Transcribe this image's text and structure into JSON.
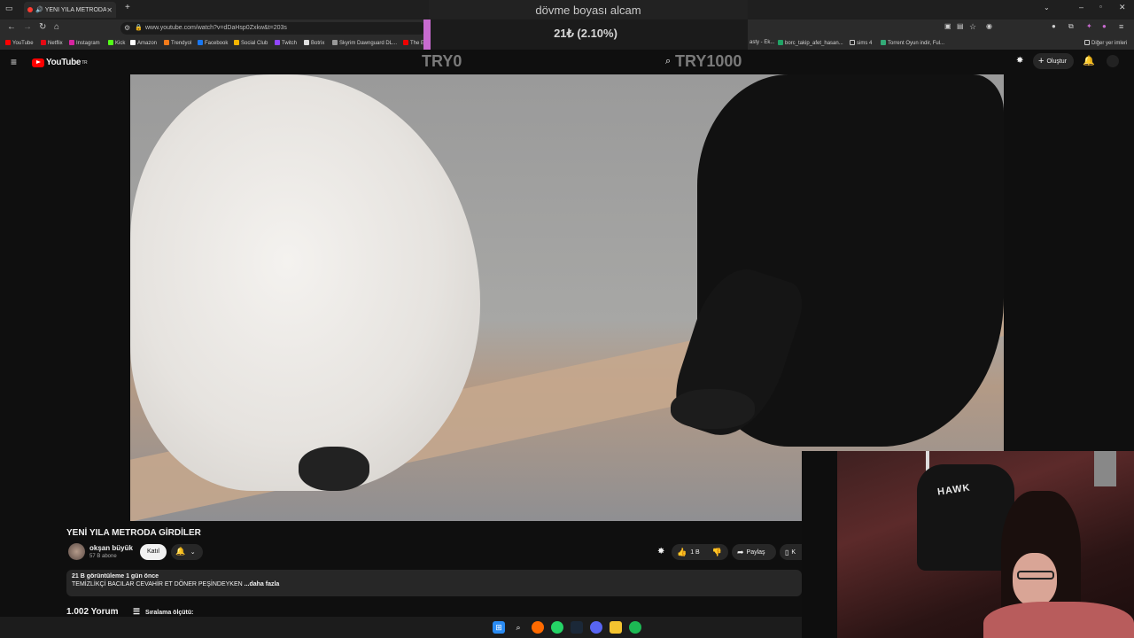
{
  "browser": {
    "tab_title": "YENİ YILA METRODA GİRDİ",
    "url": "www.youtube.com/watch?v=dDaHsp0Zxkw&t=203s",
    "bookmarks": [
      "YouTube",
      "Netflix",
      "Instagram",
      "Kick",
      "Amazon",
      "Trendyol",
      "Facebook",
      "Social Club",
      "Twitch",
      "Botrix",
      "Skyrim Dawnguard DL...",
      "The E",
      "asty - Ek...",
      "borc_takip_afet_hasan...",
      "sims 4",
      "Torrent Oyun indir, Ful...",
      "Diğer yer imleri"
    ]
  },
  "overlay": {
    "goal_title": "dövme boyası alcam",
    "goal_text": "21₺ (2.10%)",
    "goal_percent": 2.1,
    "min_label": "TRY0",
    "max_label": "TRY1000"
  },
  "youtube": {
    "logo_text": "YouTube",
    "logo_region": "TR",
    "create_label": "Oluştur",
    "video_title": "YENİ YILA METRODA GİRDİLER",
    "channel_name": "okşan büyük",
    "subscribers": "57 B abone",
    "join_label": "Katıl",
    "likes": "1 B",
    "share_label": "Paylaş",
    "save_label_partial": "K",
    "views_date": "21 B görüntüleme  1 gün önce",
    "description": "TEMİZLİKÇİ BACILAR CEVAHİR ET DÖNER PEŞİNDEYKEN",
    "more_label": "...daha fazla",
    "comments_count": "1.002 Yorum",
    "sort_label": "Sıralama ölçütü:"
  },
  "webcam": {
    "chair_text": "HAWK"
  },
  "colors": {
    "goal_fill": "#c86bd0",
    "yt_red": "#ff0000"
  }
}
